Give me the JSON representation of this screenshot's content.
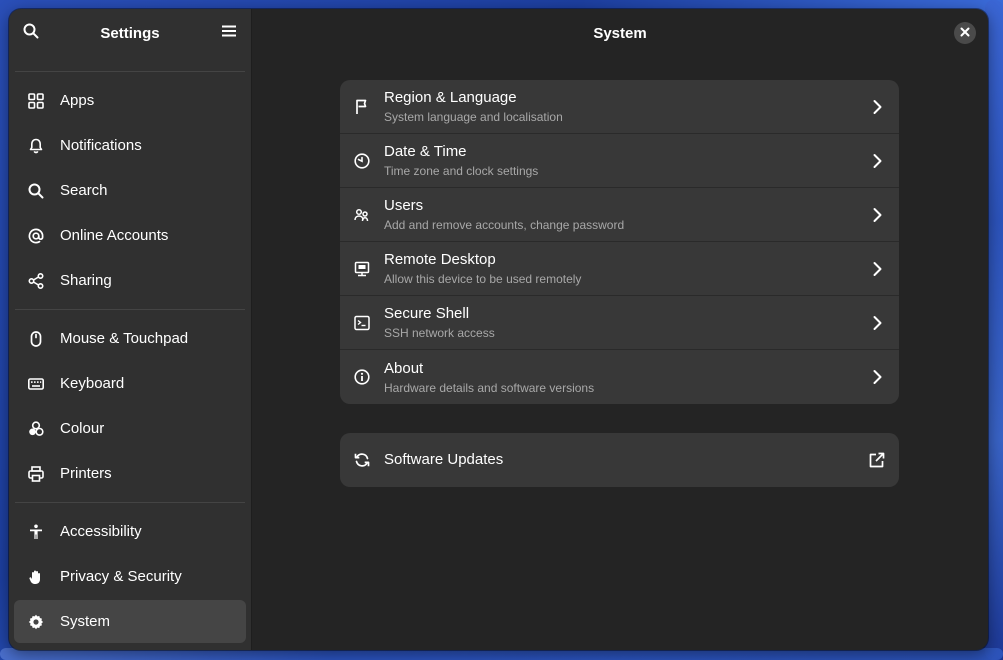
{
  "sidebar": {
    "title": "Settings",
    "groups": [
      [
        {
          "label": "Apps",
          "icon": "apps-icon"
        },
        {
          "label": "Notifications",
          "icon": "bell-icon"
        },
        {
          "label": "Search",
          "icon": "search-icon"
        },
        {
          "label": "Online Accounts",
          "icon": "at-sign-icon"
        },
        {
          "label": "Sharing",
          "icon": "share-icon"
        }
      ],
      [
        {
          "label": "Mouse & Touchpad",
          "icon": "mouse-icon"
        },
        {
          "label": "Keyboard",
          "icon": "keyboard-icon"
        },
        {
          "label": "Colour",
          "icon": "color-icon"
        },
        {
          "label": "Printers",
          "icon": "printer-icon"
        }
      ],
      [
        {
          "label": "Accessibility",
          "icon": "accessibility-icon"
        },
        {
          "label": "Privacy & Security",
          "icon": "hand-icon"
        },
        {
          "label": "System",
          "icon": "gear-icon",
          "active": true
        }
      ]
    ]
  },
  "main": {
    "title": "System",
    "rows": [
      {
        "title": "Region & Language",
        "subtitle": "System language and localisation",
        "icon": "flag-icon"
      },
      {
        "title": "Date & Time",
        "subtitle": "Time zone and clock settings",
        "icon": "clock-icon"
      },
      {
        "title": "Users",
        "subtitle": "Add and remove accounts, change password",
        "icon": "users-icon"
      },
      {
        "title": "Remote Desktop",
        "subtitle": "Allow this device to be used remotely",
        "icon": "remote-desktop-icon"
      },
      {
        "title": "Secure Shell",
        "subtitle": "SSH network access",
        "icon": "terminal-icon"
      },
      {
        "title": "About",
        "subtitle": "Hardware details and software versions",
        "icon": "info-icon"
      }
    ],
    "updates": {
      "title": "Software Updates",
      "icon": "refresh-icon"
    }
  },
  "colors": {
    "window_bg": "#242424",
    "sidebar_bg": "#303030",
    "card_bg": "#383838",
    "active_item_bg": "#454545",
    "subtitle_text": "#a8a8a8"
  }
}
